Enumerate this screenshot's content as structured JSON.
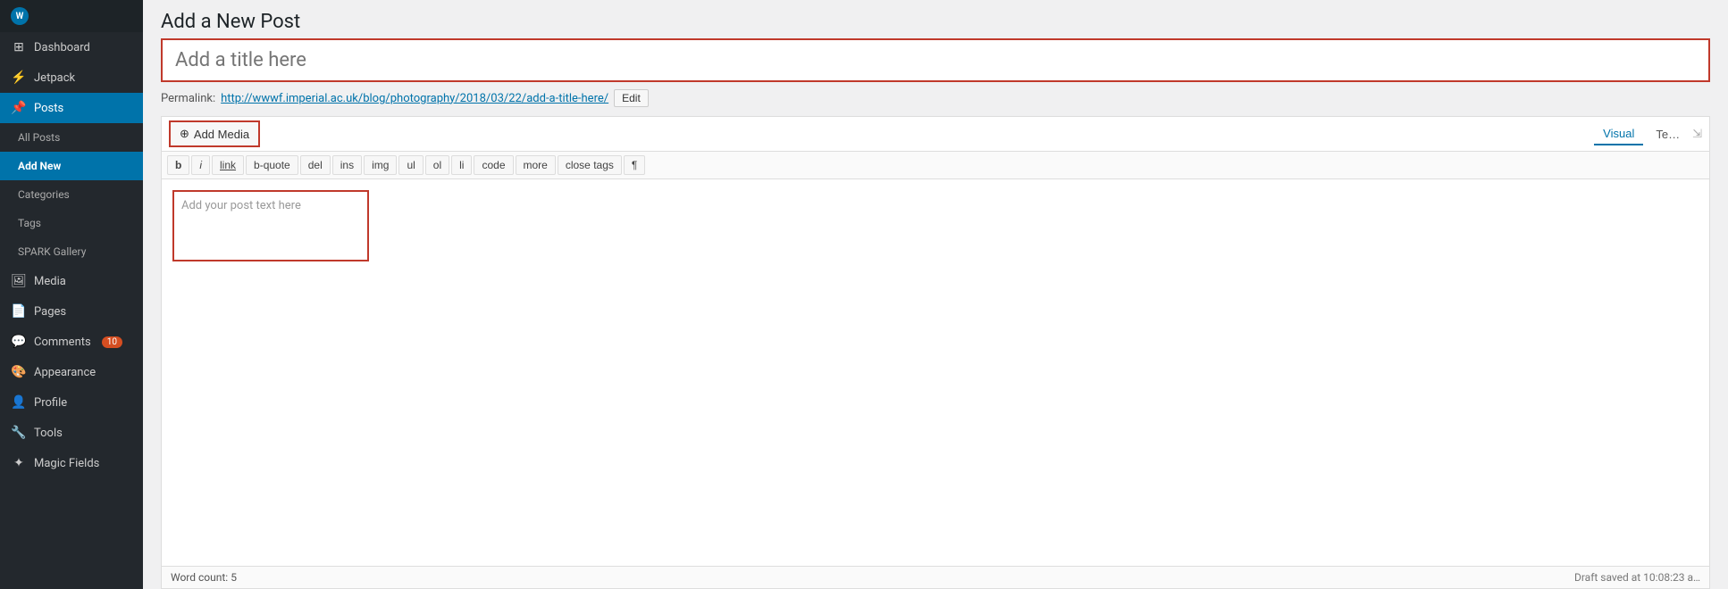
{
  "sidebar": {
    "logo_label": "W",
    "items": [
      {
        "id": "dashboard",
        "label": "Dashboard",
        "icon": "⊞",
        "active": false
      },
      {
        "id": "jetpack",
        "label": "Jetpack",
        "icon": "⚡",
        "active": false
      },
      {
        "id": "posts",
        "label": "Posts",
        "icon": "📌",
        "active": true
      },
      {
        "id": "all-posts",
        "label": "All Posts",
        "sub": true,
        "active": false
      },
      {
        "id": "add-new",
        "label": "Add New",
        "sub": true,
        "active": true
      },
      {
        "id": "categories",
        "label": "Categories",
        "sub": true,
        "active": false
      },
      {
        "id": "tags",
        "label": "Tags",
        "sub": true,
        "active": false
      },
      {
        "id": "spark-gallery",
        "label": "SPARK Gallery",
        "sub": true,
        "active": false
      },
      {
        "id": "media",
        "label": "Media",
        "icon": "🖼",
        "active": false
      },
      {
        "id": "pages",
        "label": "Pages",
        "icon": "📄",
        "active": false
      },
      {
        "id": "comments",
        "label": "Comments",
        "icon": "💬",
        "badge": "10",
        "active": false
      },
      {
        "id": "appearance",
        "label": "Appearance",
        "icon": "🎨",
        "active": false
      },
      {
        "id": "profile",
        "label": "Profile",
        "icon": "👤",
        "active": false
      },
      {
        "id": "tools",
        "label": "Tools",
        "icon": "🔧",
        "active": false
      },
      {
        "id": "magic-fields",
        "label": "Magic Fields",
        "icon": "✦",
        "active": false
      }
    ]
  },
  "page": {
    "title": "Add a New Post"
  },
  "title_input": {
    "placeholder": "Add a title here",
    "value": ""
  },
  "permalink": {
    "label": "Permalink:",
    "url": "http://wwwf.imperial.ac.uk/blog/photography/2018/03/22/add-a-title-here/",
    "edit_label": "Edit"
  },
  "editor": {
    "add_media_label": "Add Media",
    "tabs": [
      {
        "id": "visual",
        "label": "Visual",
        "active": true
      },
      {
        "id": "text",
        "label": "Te…",
        "active": false
      }
    ],
    "toolbar_buttons": [
      {
        "id": "bold",
        "label": "b"
      },
      {
        "id": "italic",
        "label": "i"
      },
      {
        "id": "link",
        "label": "link"
      },
      {
        "id": "bquote",
        "label": "b-quote"
      },
      {
        "id": "del",
        "label": "del"
      },
      {
        "id": "ins",
        "label": "ins"
      },
      {
        "id": "img",
        "label": "img"
      },
      {
        "id": "ul",
        "label": "ul"
      },
      {
        "id": "ol",
        "label": "ol"
      },
      {
        "id": "li",
        "label": "li"
      },
      {
        "id": "code",
        "label": "code"
      },
      {
        "id": "more",
        "label": "more"
      },
      {
        "id": "close-tags",
        "label": "close tags"
      },
      {
        "id": "paragraph",
        "label": "¶"
      }
    ],
    "body_placeholder": "Add your post text here",
    "footer": {
      "word_count_label": "Word count:",
      "word_count": "5",
      "draft_saved": "Draft saved at 10:08:23 a…"
    }
  },
  "icons": {
    "add_media": "⊕"
  }
}
